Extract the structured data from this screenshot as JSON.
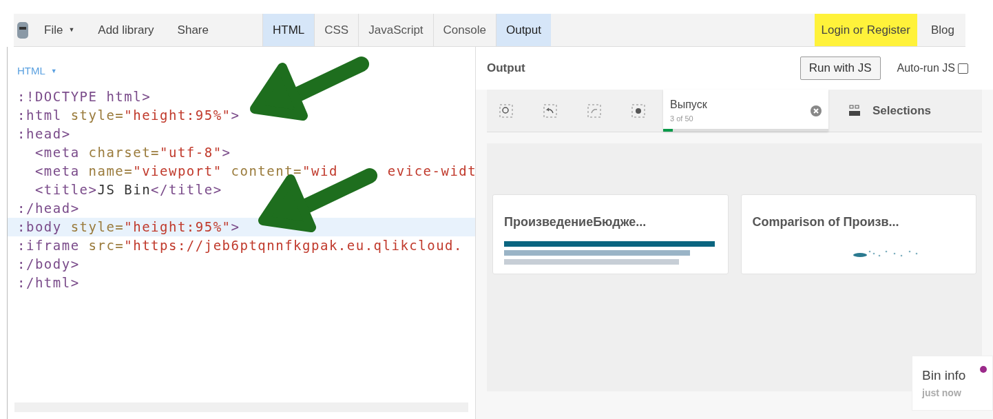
{
  "menu": [
    {
      "label": "File",
      "caret": "▼"
    },
    {
      "label": "Add library"
    },
    {
      "label": "Share"
    }
  ],
  "tabs": [
    {
      "label": "HTML",
      "selected": true
    },
    {
      "label": "CSS",
      "selected": false
    },
    {
      "label": "JavaScript",
      "selected": false
    },
    {
      "label": "Console",
      "selected": false
    },
    {
      "label": "Output",
      "selected": true
    }
  ],
  "login": "Login or Register",
  "blog": "Blog",
  "editor": {
    "title": "HTML",
    "caret": "▼",
    "lines": [
      {
        "highlighted": false,
        "segments": [
          {
            "kind": "tag",
            "text": ":!DOCTYPE html>"
          }
        ]
      },
      {
        "highlighted": false,
        "segments": [
          {
            "kind": "tag",
            "text": ":html"
          },
          {
            "kind": "attr",
            "text": " style="
          },
          {
            "kind": "string",
            "text": "\"height:95%\""
          },
          {
            "kind": "tag",
            "text": ">"
          }
        ]
      },
      {
        "highlighted": false,
        "segments": [
          {
            "kind": "tag",
            "text": ":head>"
          }
        ]
      },
      {
        "highlighted": false,
        "segments": [
          {
            "kind": "tag",
            "text": "  <meta"
          },
          {
            "kind": "attr",
            "text": " charset="
          },
          {
            "kind": "string",
            "text": "\"utf-8\""
          },
          {
            "kind": "tag",
            "text": ">"
          }
        ]
      },
      {
        "highlighted": false,
        "segments": [
          {
            "kind": "tag",
            "text": "  <meta"
          },
          {
            "kind": "attr",
            "text": " name="
          },
          {
            "kind": "string",
            "text": "\"viewport\""
          },
          {
            "kind": "attr",
            "text": " content="
          },
          {
            "kind": "string",
            "text": "\"wid"
          },
          {
            "kind": "string",
            "text": "evice-widt",
            "covered_before": true
          }
        ]
      },
      {
        "highlighted": false,
        "segments": [
          {
            "kind": "tag",
            "text": "  <title>"
          },
          {
            "kind": "text",
            "text": "JS Bin"
          },
          {
            "kind": "tag",
            "text": "</title>"
          }
        ]
      },
      {
        "highlighted": false,
        "segments": [
          {
            "kind": "tag",
            "text": ":/head>"
          }
        ]
      },
      {
        "highlighted": true,
        "segments": [
          {
            "kind": "tag",
            "text": ":body"
          },
          {
            "kind": "attr",
            "text": " style="
          },
          {
            "kind": "string",
            "text": "\"height:95%\""
          },
          {
            "kind": "tag",
            "text": ">"
          }
        ]
      },
      {
        "highlighted": false,
        "segments": [
          {
            "kind": "tag",
            "text": ":iframe"
          },
          {
            "kind": "attr",
            "text": " src="
          },
          {
            "kind": "string",
            "text": "\"https://jeb6ptqnnfkgpak.eu.qlikcloud."
          }
        ]
      },
      {
        "highlighted": false,
        "segments": [
          {
            "kind": "tag",
            "text": ":/body>"
          }
        ]
      },
      {
        "highlighted": false,
        "segments": [
          {
            "kind": "tag",
            "text": ":/html>"
          }
        ]
      }
    ]
  },
  "output": {
    "title": "Output",
    "run_button": "Run with JS",
    "autorun": {
      "label": "Auto-run JS",
      "checked": false
    },
    "selection": {
      "field": "Выпуск",
      "count": "3 of 50",
      "level": 0.06
    },
    "selections_label": "Selections",
    "cards": [
      {
        "title": "ПроизведениеБюдже...",
        "kind": "bars"
      },
      {
        "title": "Comparison of Произв...",
        "kind": "scatter"
      }
    ]
  },
  "bin_info": {
    "title": "Bin info",
    "time": "just now"
  }
}
